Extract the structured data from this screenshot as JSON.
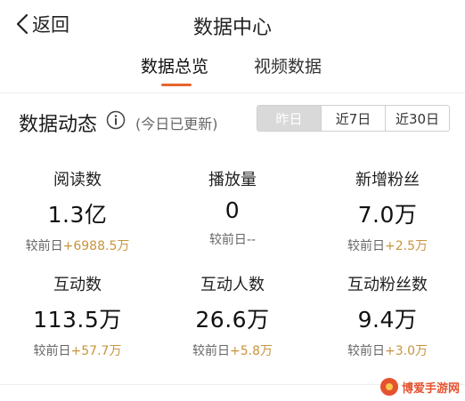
{
  "header": {
    "back_label": "返回",
    "title": "数据中心"
  },
  "tabs": [
    {
      "label": "数据总览",
      "active": true
    },
    {
      "label": "视频数据",
      "active": false
    }
  ],
  "section": {
    "title": "数据动态",
    "update_note": "(今日已更新)",
    "range_options": [
      {
        "label": "昨日",
        "active": true
      },
      {
        "label": "近7日",
        "active": false
      },
      {
        "label": "近30日",
        "active": false
      }
    ]
  },
  "stats": [
    {
      "label": "阅读数",
      "value": "1.3亿",
      "compare_prefix": "较前日",
      "delta": "+6988.5万"
    },
    {
      "label": "播放量",
      "value": "0",
      "compare_prefix": "较前日",
      "delta": "--"
    },
    {
      "label": "新增粉丝",
      "value": "7.0万",
      "compare_prefix": "较前日",
      "delta": "+2.5万"
    },
    {
      "label": "互动数",
      "value": "113.5万",
      "compare_prefix": "较前日",
      "delta": "+57.7万"
    },
    {
      "label": "互动人数",
      "value": "26.6万",
      "compare_prefix": "较前日",
      "delta": "+5.8万"
    },
    {
      "label": "互动粉丝数",
      "value": "9.4万",
      "compare_prefix": "较前日",
      "delta": "+3.0万"
    }
  ],
  "watermark": {
    "text": "博爱手游网"
  },
  "colors": {
    "accent": "#e8652b",
    "delta": "#c8943e",
    "segment_active": "#d9d9d9"
  }
}
